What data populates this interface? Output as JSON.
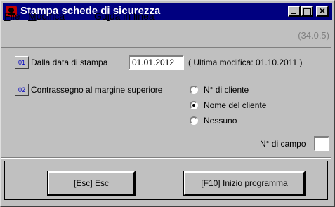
{
  "window": {
    "title": "Stampa schede di sicurezza",
    "version": "(34.0.5)"
  },
  "menu": [
    {
      "pre": "",
      "u": "F",
      "post": "ile"
    },
    {
      "pre": "",
      "u": "M",
      "post": "odifica"
    },
    {
      "pre": "Gu",
      "u": "i",
      "post": "da in linea"
    }
  ],
  "row1": {
    "num": "01",
    "label": "Dalla data di stampa",
    "date_value": "01.01.2012",
    "info": "( Ultima modifica:  01.10.2011      )"
  },
  "row2": {
    "num": "02",
    "label": "Contrassegno al margine superiore",
    "options": [
      "N° di cliente",
      "Nome del cliente",
      "Nessuno"
    ],
    "selected_index": 1
  },
  "campo": {
    "label": "N° di campo",
    "value": ""
  },
  "buttons": {
    "esc": {
      "pre": "[Esc] ",
      "u": "E",
      "post": "sc"
    },
    "f10": {
      "pre": "[F10] ",
      "u": "I",
      "post": "nizio programma"
    }
  }
}
